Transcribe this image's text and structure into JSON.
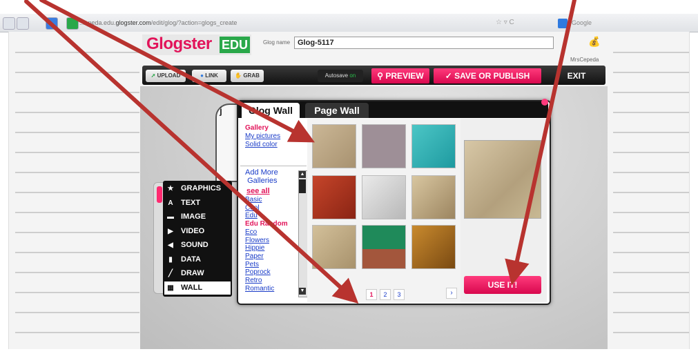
{
  "browser": {
    "url_prefix": "...epeda.edu.",
    "url_domain": "glogster.com",
    "url_path": "/edit/glog/?action=glogs_create",
    "search_engine": "Google"
  },
  "header": {
    "logo_text": "Glogster",
    "logo_badge": "EDU",
    "glog_name_label": "Glog name",
    "glog_name_value": "Glog-5117",
    "username": "MrsCepeda"
  },
  "toolbar": {
    "upload": "UPLOAD",
    "link": "LINK",
    "grab": "GRAB",
    "autosave": "Autosave",
    "autosave_state": "on",
    "preview": "PREVIEW",
    "save_publish": "SAVE OR PUBLISH",
    "exit": "EXIT"
  },
  "tools": [
    {
      "label": "GRAPHICS",
      "icon": "star-icon"
    },
    {
      "label": "TEXT",
      "icon": "text-icon"
    },
    {
      "label": "IMAGE",
      "icon": "image-icon"
    },
    {
      "label": "VIDEO",
      "icon": "video-icon"
    },
    {
      "label": "SOUND",
      "icon": "sound-icon"
    },
    {
      "label": "DATA",
      "icon": "data-icon"
    },
    {
      "label": "DRAW",
      "icon": "pencil-icon"
    },
    {
      "label": "WALL",
      "icon": "wall-icon"
    }
  ],
  "dialog": {
    "tab_glog": "Glog Wall",
    "tab_page": "Page Wall",
    "gallery_label": "Gallery",
    "my_pictures": "My pictures",
    "solid_color": "Solid color",
    "add_more_line1": "Add More",
    "add_more_line2": "Galleries",
    "see_all": "see all",
    "categories": [
      "Basic",
      "Cool",
      "Edu",
      "Edu Random",
      "Eco",
      "Flowers",
      "Hippie",
      "Paper",
      "Pets",
      "Poprock",
      "Retro",
      "Romantic"
    ],
    "active_category": "Edu Random",
    "pages": [
      "1",
      "2",
      "3"
    ],
    "next": "›",
    "use_it": "USE IT!"
  },
  "canvas": {
    "glyph": "j"
  },
  "colors": {
    "brand_pink": "#e2145a",
    "edu_green": "#2aa84a",
    "arrow_red": "#b8332f"
  }
}
